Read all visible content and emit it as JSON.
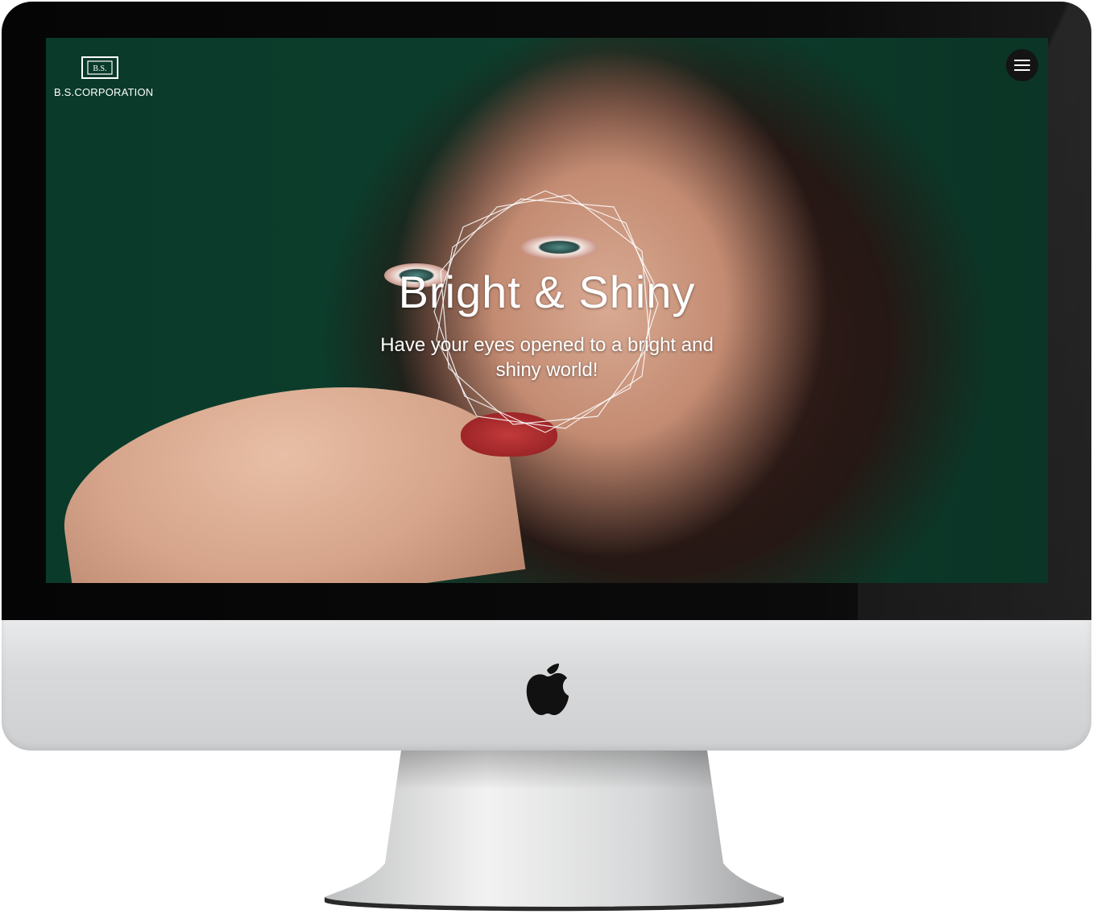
{
  "header": {
    "logo_mark_text": "B.S.",
    "logo_text": "B.S.CORPORATION",
    "menu_icon": "hamburger-menu-icon"
  },
  "hero": {
    "title": "Bright & Shiny",
    "subtitle": "Have your eyes opened to a bright and shiny world!",
    "background_color": "#0e3b2a"
  },
  "device": {
    "brand_icon": "apple-logo-icon"
  }
}
